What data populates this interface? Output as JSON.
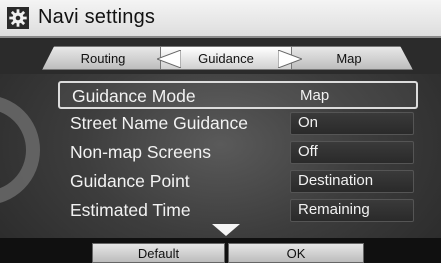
{
  "header": {
    "title": "Navi settings",
    "icon": "gear-icon"
  },
  "tabs": [
    {
      "label": "Routing",
      "selected": false
    },
    {
      "label": "Guidance",
      "selected": true
    },
    {
      "label": "Map",
      "selected": false
    }
  ],
  "settings": [
    {
      "label": "Guidance Mode",
      "value": "Map",
      "selected": true
    },
    {
      "label": "Street Name Guidance",
      "value": "On",
      "selected": false
    },
    {
      "label": "Non-map Screens",
      "value": "Off",
      "selected": false
    },
    {
      "label": "Guidance Point",
      "value": "Destination",
      "selected": false
    },
    {
      "label": "Estimated Time",
      "value": "Remaining",
      "selected": false
    }
  ],
  "footer": {
    "default_label": "Default",
    "ok_label": "OK"
  },
  "colors": {
    "title_bar": "#e8e8e8",
    "background": "#3d3d3d",
    "text": "#f2f2f2"
  }
}
